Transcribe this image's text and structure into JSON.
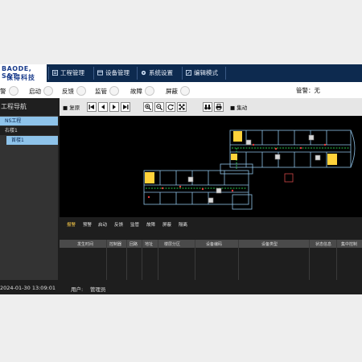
{
  "header": {
    "logo_en": "BAODE, S&T",
    "logo_cn": "保得科技",
    "menu": [
      {
        "label": "工程管理",
        "icon": "project-icon"
      },
      {
        "label": "设备管理",
        "icon": "device-icon"
      },
      {
        "label": "系统设置",
        "icon": "gear-icon"
      },
      {
        "label": "编辑模式",
        "icon": "edit-icon"
      }
    ]
  },
  "status": {
    "items": [
      {
        "label": "警"
      },
      {
        "label": "启动"
      },
      {
        "label": "反馈"
      },
      {
        "label": "监管"
      },
      {
        "label": "故障"
      },
      {
        "label": "屏蔽"
      }
    ],
    "guard": "管警：无"
  },
  "sidebar": {
    "title": "工程导航",
    "tree": [
      "NS工程",
      "右楼1",
      "首楼1"
    ]
  },
  "toolbar": {
    "left_label": "复原",
    "right_label": "集动",
    "buttons": [
      "first-page-icon",
      "prev-page-icon",
      "next-page-icon",
      "last-page-icon",
      "zoom-in-icon",
      "zoom-out-icon",
      "refresh-icon",
      "fit-screen-icon",
      "binoculars-icon",
      "print-icon"
    ]
  },
  "bottom": {
    "tabs": [
      "报警",
      "预警",
      "启动",
      "反馈",
      "监管",
      "故障",
      "屏蔽",
      "隔离"
    ],
    "active_tab": 0,
    "columns": [
      "发生时间",
      "控制器",
      "回路",
      "地址",
      "楼层分区",
      "设备编码",
      "设备类型",
      "状态信息",
      "集中控制"
    ]
  },
  "footer": {
    "datetime": "2024-01-30 13:09:01",
    "user_label": "用户:",
    "user_name": "管理员"
  },
  "colors": {
    "header_bg": "#0d2a4f",
    "tree_highlight": "#8ec3ea",
    "active_tab": "#ffcf4a",
    "floorplan_line": "#8fc2e8",
    "evac_route": "#29c44a",
    "device_marker": "#ffd23a"
  }
}
